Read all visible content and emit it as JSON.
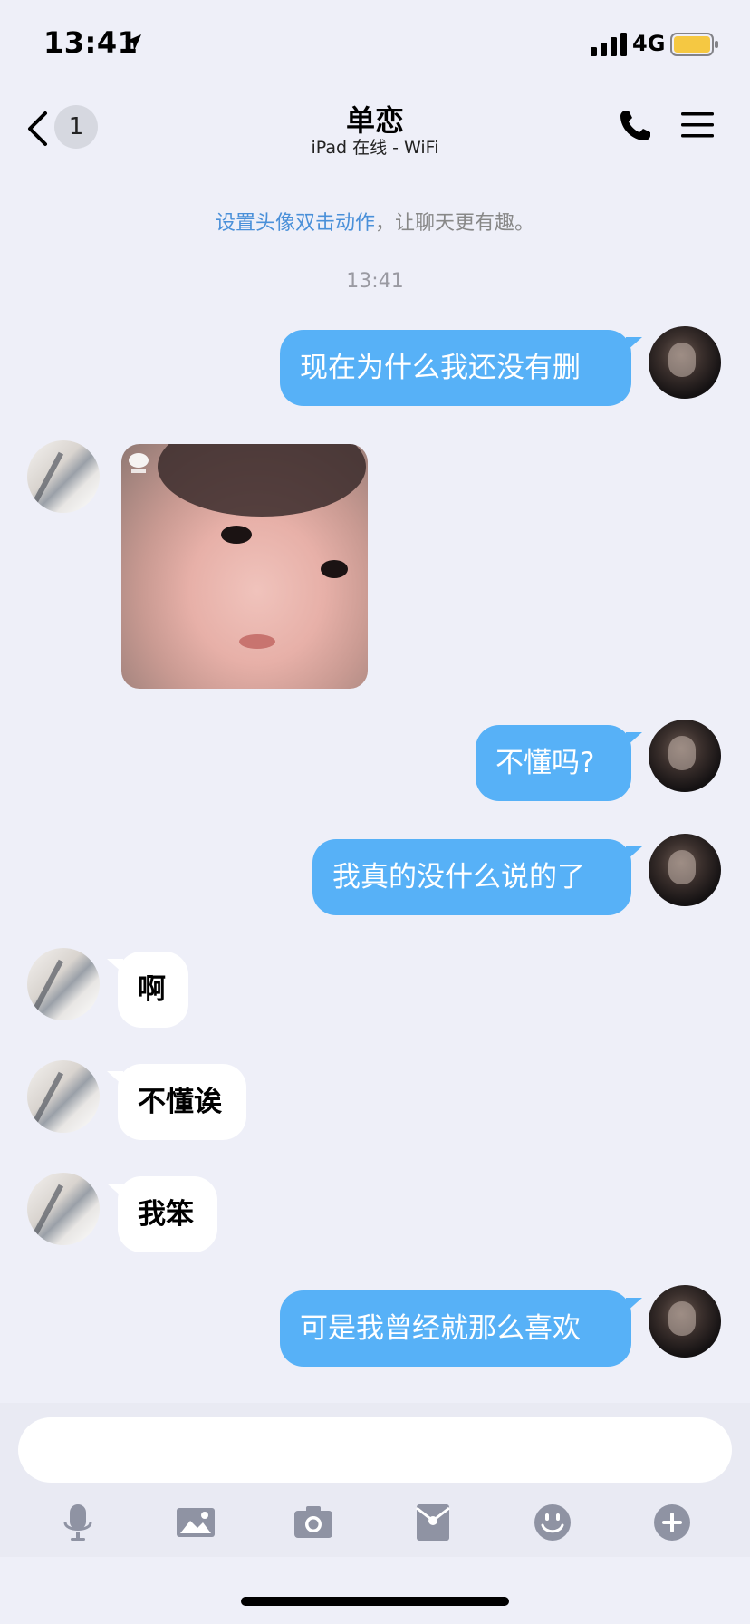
{
  "status": {
    "time": "13:41",
    "network": "4G"
  },
  "nav": {
    "back_badge": "1",
    "title": "单恋",
    "subtitle": "iPad 在线 - WiFi"
  },
  "tip": {
    "link": "设置头像双击动作",
    "rest": "，让聊天更有趣。"
  },
  "timestamp": "13:41",
  "messages": {
    "m1": "现在为什么我还没有删",
    "m3": "不懂吗?",
    "m4": "我真的没什么说的了",
    "m5": "啊",
    "m6": "不懂诶",
    "m7": "我笨",
    "m8": "可是我曾经就那么喜欢"
  },
  "input": {
    "placeholder": ""
  },
  "toolbar": [
    "microphone-icon",
    "image-icon",
    "camera-icon",
    "red-packet-icon",
    "emoji-icon",
    "plus-icon"
  ],
  "colors": {
    "bubble_me": "#57b1f7",
    "background": "#eeeff8",
    "link": "#4a90d9"
  }
}
